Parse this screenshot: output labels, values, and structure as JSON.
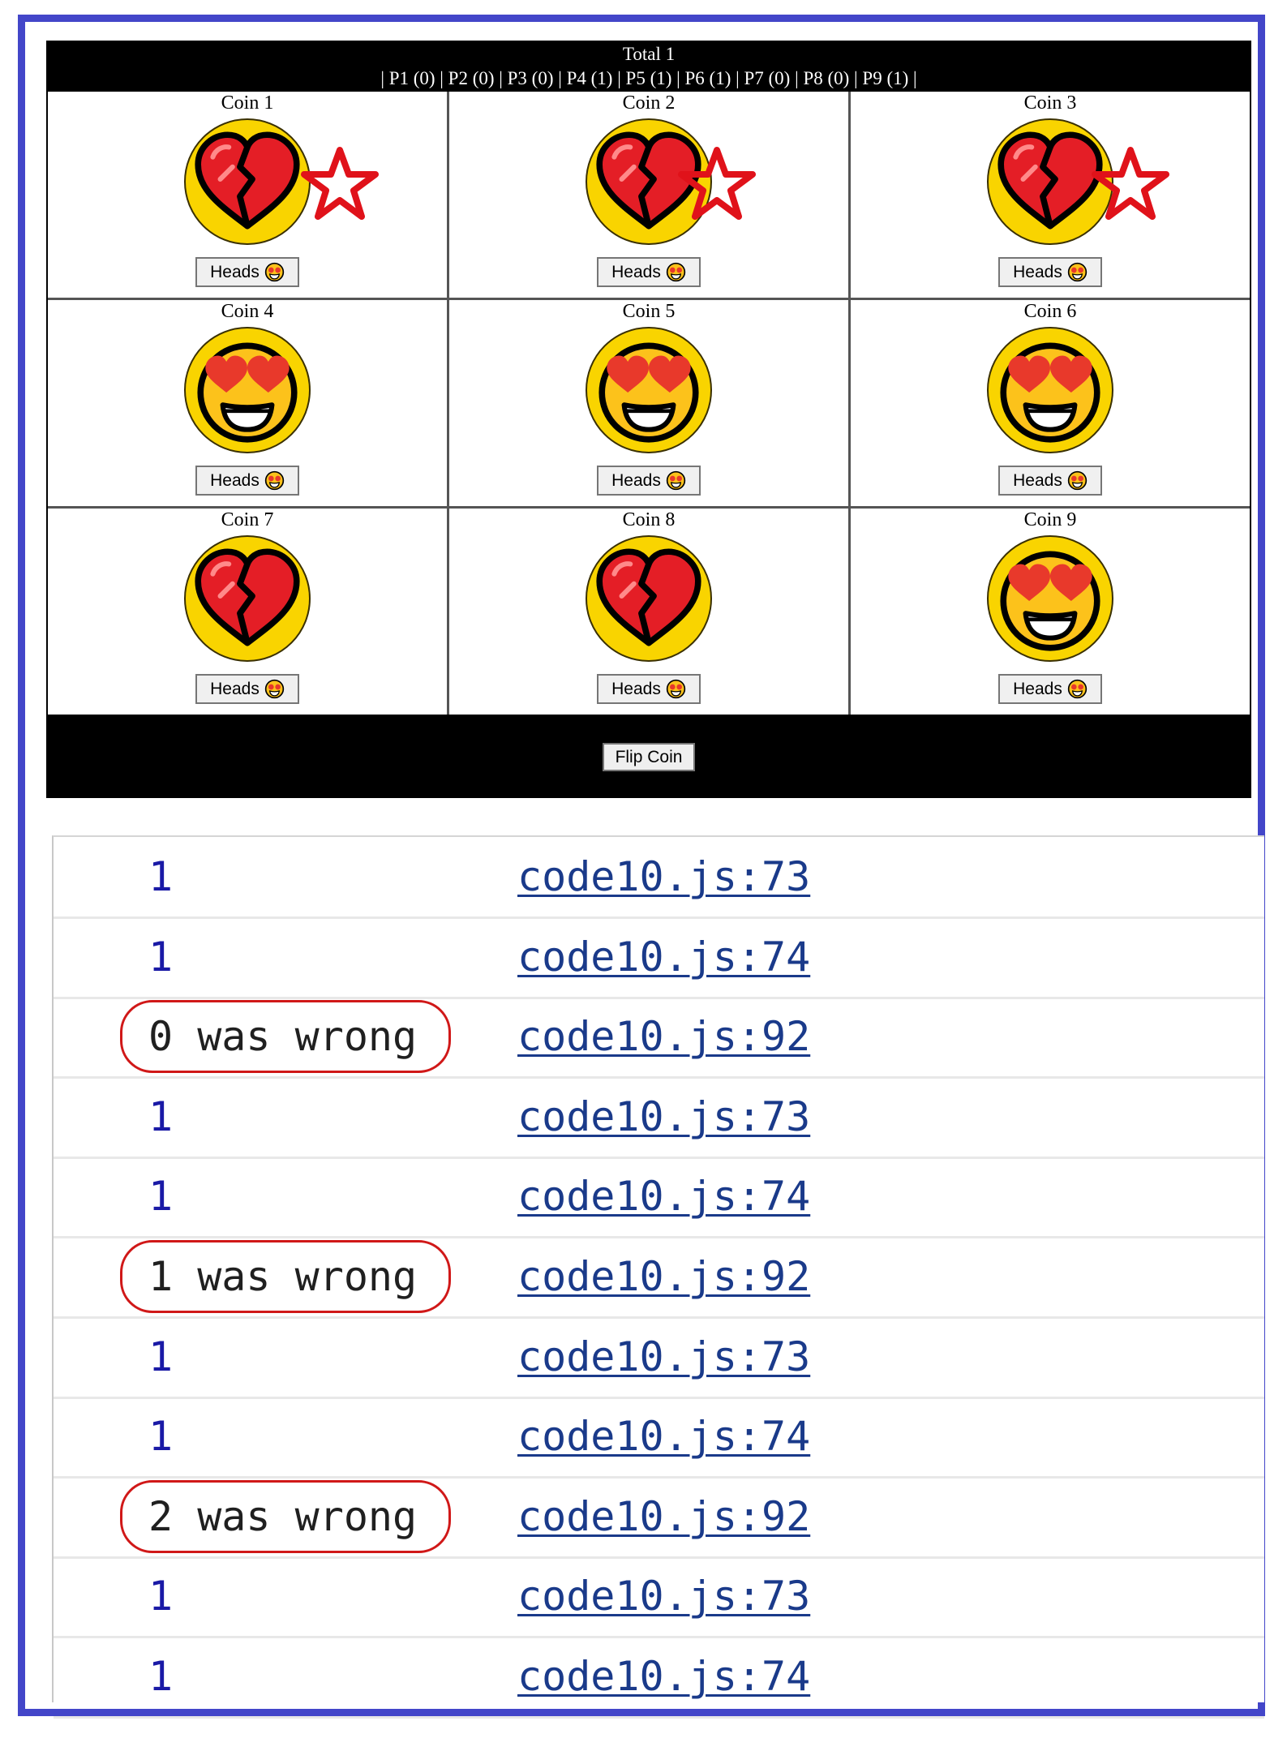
{
  "header": {
    "total": "Total 1",
    "players": "| P1 (0) | P2 (0) | P3 (0) | P4 (1) | P5 (1) | P6 (1) | P7 (0) | P8 (0) | P9 (1) |"
  },
  "coins": [
    {
      "label": "Coin 1",
      "face": "broken-heart",
      "button": "Heads"
    },
    {
      "label": "Coin 2",
      "face": "broken-heart",
      "button": "Heads"
    },
    {
      "label": "Coin 3",
      "face": "broken-heart",
      "button": "Heads"
    },
    {
      "label": "Coin 4",
      "face": "heart-eyes",
      "button": "Heads"
    },
    {
      "label": "Coin 5",
      "face": "heart-eyes",
      "button": "Heads"
    },
    {
      "label": "Coin 6",
      "face": "heart-eyes",
      "button": "Heads"
    },
    {
      "label": "Coin 7",
      "face": "broken-heart",
      "button": "Heads"
    },
    {
      "label": "Coin 8",
      "face": "broken-heart",
      "button": "Heads"
    },
    {
      "label": "Coin 9",
      "face": "heart-eyes",
      "button": "Heads"
    }
  ],
  "flip_button": "Flip Coin",
  "console": [
    {
      "message": "1",
      "source": "code10.js:73"
    },
    {
      "message": "1",
      "source": "code10.js:74"
    },
    {
      "message": "0 was wrong",
      "source": "code10.js:92"
    },
    {
      "message": "1",
      "source": "code10.js:73"
    },
    {
      "message": "1",
      "source": "code10.js:74"
    },
    {
      "message": "1 was wrong",
      "source": "code10.js:92"
    },
    {
      "message": "1",
      "source": "code10.js:73"
    },
    {
      "message": "1",
      "source": "code10.js:74"
    },
    {
      "message": "2 was wrong",
      "source": "code10.js:92"
    },
    {
      "message": "1",
      "source": "code10.js:73"
    },
    {
      "message": "1",
      "source": "code10.js:74"
    }
  ],
  "colors": {
    "frame": "#4346c9",
    "annotation": "#d01818",
    "coin_yellow": "#f9d400"
  }
}
